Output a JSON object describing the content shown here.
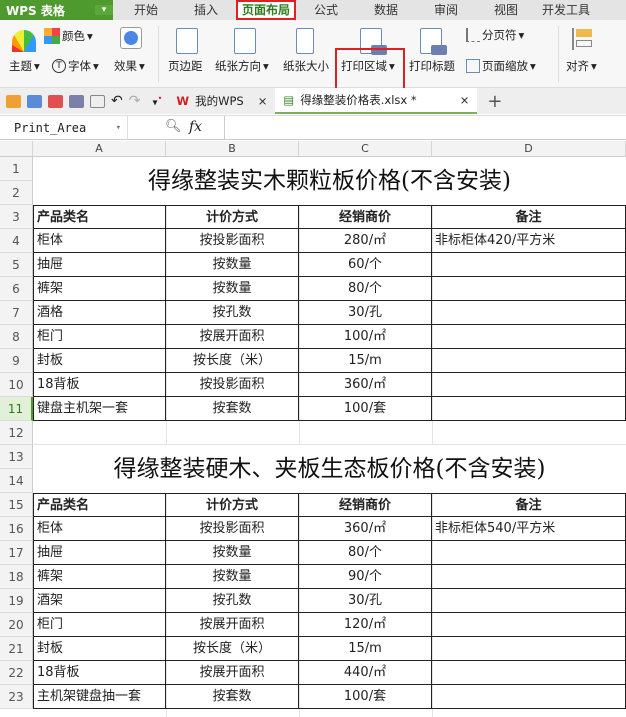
{
  "app": {
    "logo": "WPS 表格"
  },
  "tabs": [
    "开始",
    "插入",
    "页面布局",
    "公式",
    "数据",
    "审阅",
    "视图",
    "开发工具"
  ],
  "active_tab": 2,
  "ribbon": {
    "theme": "主题",
    "colors": "颜色",
    "fonts": "字体",
    "effects": "效果",
    "margins": "页边距",
    "orientation": "纸张方向",
    "size": "纸张大小",
    "print_area": "打印区域",
    "print_titles": "打印标题",
    "page_break": "分页符",
    "page_zoom": "页面缩放",
    "align": "对齐"
  },
  "doc_tabs": {
    "my_wps": "我的WPS",
    "file": "得缘整装价格表.xlsx *"
  },
  "formula_bar": {
    "name_box": "Print_Area",
    "fx": "fx",
    "value": ""
  },
  "columns": [
    "A",
    "B",
    "C",
    "D"
  ],
  "selected_row": 11,
  "sheet": {
    "title1": "得缘整装实木颗粒板价格(不含安装)",
    "title2": "得缘整装硬木、夹板生态板价格(不含安装)",
    "headers": [
      "产品类名",
      "计价方式",
      "经销商价",
      "备注"
    ],
    "table1": [
      [
        "柜体",
        "按投影面积",
        "280/㎡",
        "非标柜体420/平方米"
      ],
      [
        "抽屉",
        "按数量",
        "60/个",
        ""
      ],
      [
        "裤架",
        "按数量",
        "80/个",
        ""
      ],
      [
        "酒格",
        "按孔数",
        "30/孔",
        ""
      ],
      [
        "柜门",
        "按展开面积",
        "100/㎡",
        ""
      ],
      [
        "封板",
        "按长度（米）",
        "15/m",
        ""
      ],
      [
        "18背板",
        "按投影面积",
        "360/㎡",
        ""
      ],
      [
        "键盘主机架一套",
        "按套数",
        "100/套",
        ""
      ]
    ],
    "table2": [
      [
        "柜体",
        "按投影面积",
        "360/㎡",
        "非标柜体540/平方米"
      ],
      [
        "抽屉",
        "按数量",
        "80/个",
        ""
      ],
      [
        "裤架",
        "按数量",
        "90/个",
        ""
      ],
      [
        "酒架",
        "按孔数",
        "30/孔",
        ""
      ],
      [
        "柜门",
        "按展开面积",
        "120/㎡",
        ""
      ],
      [
        "封板",
        "按长度（米）",
        "15/m",
        ""
      ],
      [
        "18背板",
        "按展开面积",
        "440/㎡",
        ""
      ],
      [
        "主机架键盘抽一套",
        "按套数",
        "100/套",
        ""
      ]
    ]
  }
}
